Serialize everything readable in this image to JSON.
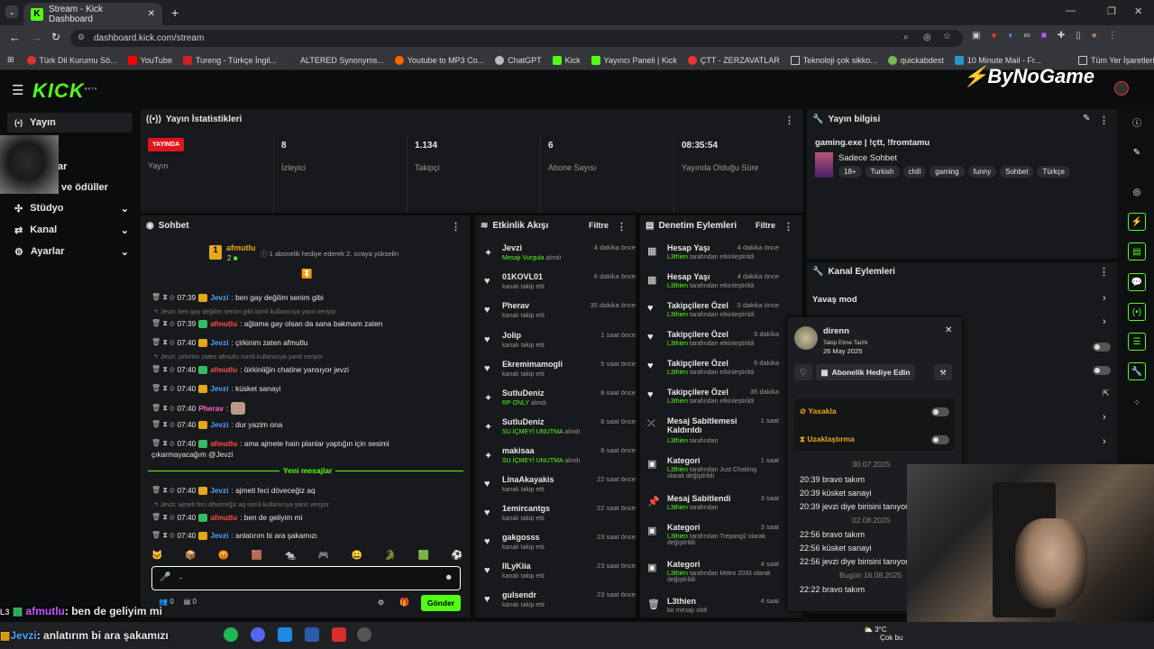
{
  "browser": {
    "tab_title": "Stream - Kick Dashboard",
    "url": "dashboard.kick.com/stream",
    "bookmarks": [
      "Türk Dil Kurumu Sö...",
      "YouTube",
      "Tureng - Türkçe İngil...",
      "ALTERED Synonyms...",
      "Youtube to MP3 Co...",
      "ChatGPT",
      "Kick",
      "Yayıncı Paneli | Kick",
      "ÇTT - ZERZAVATLAR",
      "Teknoloji çok sikko...",
      "quickabdest",
      "10 Minute Mail - Fr..."
    ],
    "all_bookmarks": "Tüm Yer İşaretleri"
  },
  "brand": {
    "kick": "KICK",
    "beta": "BETA",
    "overlay": "ByNoGame"
  },
  "sidebar": {
    "items": [
      {
        "label": "Yayın"
      },
      {
        "label": "ar"
      },
      {
        "label": "ve ödüller"
      },
      {
        "label": "Stüdyo"
      },
      {
        "label": "Kanal"
      },
      {
        "label": "Ayarlar"
      }
    ]
  },
  "stats": {
    "title": "Yayın İstatistikleri",
    "live": "YAYINDA",
    "items": [
      {
        "value": "",
        "label": "Yayın"
      },
      {
        "value": "8",
        "label": "İzleyici"
      },
      {
        "value": "1.134",
        "label": "Takipçi"
      },
      {
        "value": "6",
        "label": "Abone Sayısı"
      },
      {
        "value": "08:35:54",
        "label": "Yayında Olduğu Süre"
      }
    ]
  },
  "info": {
    "title": "Yayın bilgisi",
    "stream_title": "gaming.exe | !çtt, !fromtamu",
    "category": "Sadece Sohbet",
    "tags": [
      "18+",
      "Turkish",
      "chill",
      "gaming",
      "funny",
      "Sohbet",
      "Türkçe"
    ]
  },
  "chat": {
    "title": "Sohbet",
    "top_gifter": "afmutlu",
    "top_count": "2",
    "top_note": "1 abonelik hediye ederek 2. sıraya yükselin",
    "new_messages": "Yeni mesajlar",
    "input_value": "-",
    "send": "Gönder",
    "viewers": "0",
    "footer_count": "0",
    "messages": [
      {
        "time": "07:39",
        "user": "Jevzi",
        "text": ": ben gay değilim senim gibi",
        "reply": ""
      },
      {
        "time": "07:39",
        "user": "afmutlu",
        "text": ": ağlama gay olsan da sana bakmam zaten",
        "reply": "Jevzi: ben gay değilim senim gibi isimli kullanıcıya yanıt veriyor"
      },
      {
        "time": "07:40",
        "user": "Jevzi",
        "text": ": çirkinim zaten afmutlu",
        "reply": ""
      },
      {
        "time": "07:40",
        "user": "afmutlu",
        "text": ": öirkinliğin chatine yansıyor jevzi",
        "reply": "Jevzi: çirkinim zaten afmutlu isimli kullanıcıya yanıt veriyor"
      },
      {
        "time": "07:40",
        "user": "Jevzi",
        "text": ": küsket sanayi",
        "reply": ""
      },
      {
        "time": "07:40",
        "user": "Pherav",
        "text": ":",
        "reply": ""
      },
      {
        "time": "07:40",
        "user": "Jevzi",
        "text": ": dur yazim ona",
        "reply": ""
      },
      {
        "time": "07:40",
        "user": "afmutlu",
        "text": ": ama ajmete hain planlar yaptığın için sesimi",
        "reply": ""
      },
      {
        "time": "",
        "user": "",
        "text": "çıkarmayacağım @Jevzi",
        "reply": ""
      },
      {
        "time": "07:40",
        "user": "Jevzi",
        "text": ": ajmeti feci döveceğiz aq",
        "reply": ""
      },
      {
        "time": "07:40",
        "user": "afmutlu",
        "text": ": ben de geliyim mi",
        "reply": "Jevzi: ajmeti feci döveceğiz aq isimli kullanıcıya yanıt veriyor"
      },
      {
        "time": "07:40",
        "user": "Jevzi",
        "text": ": anlatırım bi ara şakamızı",
        "reply": ""
      }
    ]
  },
  "activity": {
    "title": "Etkinlik Akışı",
    "filter": "Filtre",
    "items": [
      {
        "name": "Jevzi",
        "sub": "Mesajı Vurgula",
        "sub2": " alındı",
        "time": "4 dakika önce"
      },
      {
        "name": "01KOVL01",
        "sub": "",
        "sub2": "kanalı takip etti",
        "time": "6 dakika önce"
      },
      {
        "name": "Pherav",
        "sub": "",
        "sub2": "kanalı takip etti",
        "time": "35 dakika önce"
      },
      {
        "name": "Jolip",
        "sub": "",
        "sub2": "kanalı takip etti",
        "time": "1 saat önce"
      },
      {
        "name": "Ekremimamogli",
        "sub": "",
        "sub2": "kanalı takip etti",
        "time": "5 saat önce"
      },
      {
        "name": "SutluDeniz",
        "sub": "RP ONLY",
        "sub2": " alındı",
        "time": "8 saat önce"
      },
      {
        "name": "SutluDeniz",
        "sub": "SU İÇMEYİ UNUTMA",
        "sub2": " alındı",
        "time": "8 saat önce"
      },
      {
        "name": "makisaa",
        "sub": "SU İÇMEYİ UNUTMA",
        "sub2": " alındı",
        "time": "8 saat önce"
      },
      {
        "name": "LinaAkayakis",
        "sub": "",
        "sub2": "kanalı takip etti",
        "time": "22 saat önce"
      },
      {
        "name": "1emircantgs",
        "sub": "",
        "sub2": "kanalı takip etti",
        "time": "22 saat önce"
      },
      {
        "name": "gakgosss",
        "sub": "",
        "sub2": "kanalı takip etti",
        "time": "23 saat önce"
      },
      {
        "name": "IlLyKiia",
        "sub": "",
        "sub2": "kanalı takip etti",
        "time": "23 saat önce"
      },
      {
        "name": "gulsendr",
        "sub": "",
        "sub2": "kanalı takip etti",
        "time": "23 saat önce"
      }
    ]
  },
  "moderation": {
    "title": "Denetim Eylemleri",
    "filter": "Filtre",
    "items": [
      {
        "name": "Hesap Yaşı",
        "by": "L3thien",
        "rest": " tarafından etkinleştirildi",
        "time": "4 dakika önce"
      },
      {
        "name": "Hesap Yaşı",
        "by": "L3thien",
        "rest": " tarafından etkinleştirildi",
        "time": "4 dakika önce"
      },
      {
        "name": "Takipçilere Özel",
        "by": "L3thien",
        "rest": " tarafından etkinleştirildi",
        "time": "5 dakika önce"
      },
      {
        "name": "Takipçilere Özel",
        "by": "L3thien",
        "rest": " tarafından etkinleştirildi",
        "time": "5 dakika"
      },
      {
        "name": "Takipçilere Özel",
        "by": "L3thien",
        "rest": " tarafından etkinleştirildi",
        "time": "6 dakika"
      },
      {
        "name": "Takipçilere Özel",
        "by": "L3thien",
        "rest": " tarafından etkinleştirildi",
        "time": "35 dakika"
      },
      {
        "name": "Mesaj Sabitlemesi Kaldırıldı",
        "by": "L3thien",
        "rest": " tarafından",
        "time": "1 saat"
      },
      {
        "name": "Kategori",
        "by": "L3thien",
        "rest": " tarafından Just Chatting olarak değiştirildi",
        "time": "1 saat"
      },
      {
        "name": "Mesaj Sabitlendi",
        "by": "L3thien",
        "rest": " tarafından",
        "time": "3 saat"
      },
      {
        "name": "Kategori",
        "by": "L3thien",
        "rest": " tarafından Trepang2 olarak değiştirildi",
        "time": "3 saat"
      },
      {
        "name": "Kategori",
        "by": "L3thien",
        "rest": " tarafından Metro 2033 olarak değiştirildi",
        "time": "4 saat"
      },
      {
        "name": "L3thien",
        "by": "",
        "rest": "bir mesajı sildi",
        "time": "4 saat"
      }
    ]
  },
  "channel_actions": {
    "title": "Kanal Eylemleri",
    "slow": "Yavaş mod"
  },
  "usercard": {
    "name": "direnn",
    "follow_label": "Takip Etme Tarihi",
    "follow_date": "26 May 2025",
    "gift": "Abonelik Hediye Edin",
    "ban": "Yasakla",
    "timeout": "Uzaklaştırma",
    "history": [
      {
        "type": "date",
        "text": "30.07.2025"
      },
      {
        "type": "msg",
        "time": "20:39",
        "text": "bravo takım"
      },
      {
        "type": "msg",
        "time": "20:39",
        "text": "küsket sanayi"
      },
      {
        "type": "msg",
        "time": "20:39",
        "text": "jevzi diye birisini tanıyor"
      },
      {
        "type": "date",
        "text": "02.08.2025"
      },
      {
        "type": "msg",
        "time": "22:56",
        "text": "bravo takım"
      },
      {
        "type": "msg",
        "time": "22:56",
        "text": "küsket sanayi"
      },
      {
        "type": "msg",
        "time": "22:56",
        "text": "jevzi diye birisini tanıyor"
      },
      {
        "type": "date",
        "text": "Bugün 16.08.2025"
      },
      {
        "type": "msg",
        "time": "22:22",
        "text": "bravo takım"
      }
    ]
  },
  "overlay_chat": [
    {
      "user": "afmutlu",
      "text": ": ben de geliyim mi"
    },
    {
      "user": "Jevzi",
      "text": ": anlatırım bi ara şakamızı"
    }
  ],
  "weather": {
    "temp": "3°C",
    "desc": "Çok bu"
  }
}
